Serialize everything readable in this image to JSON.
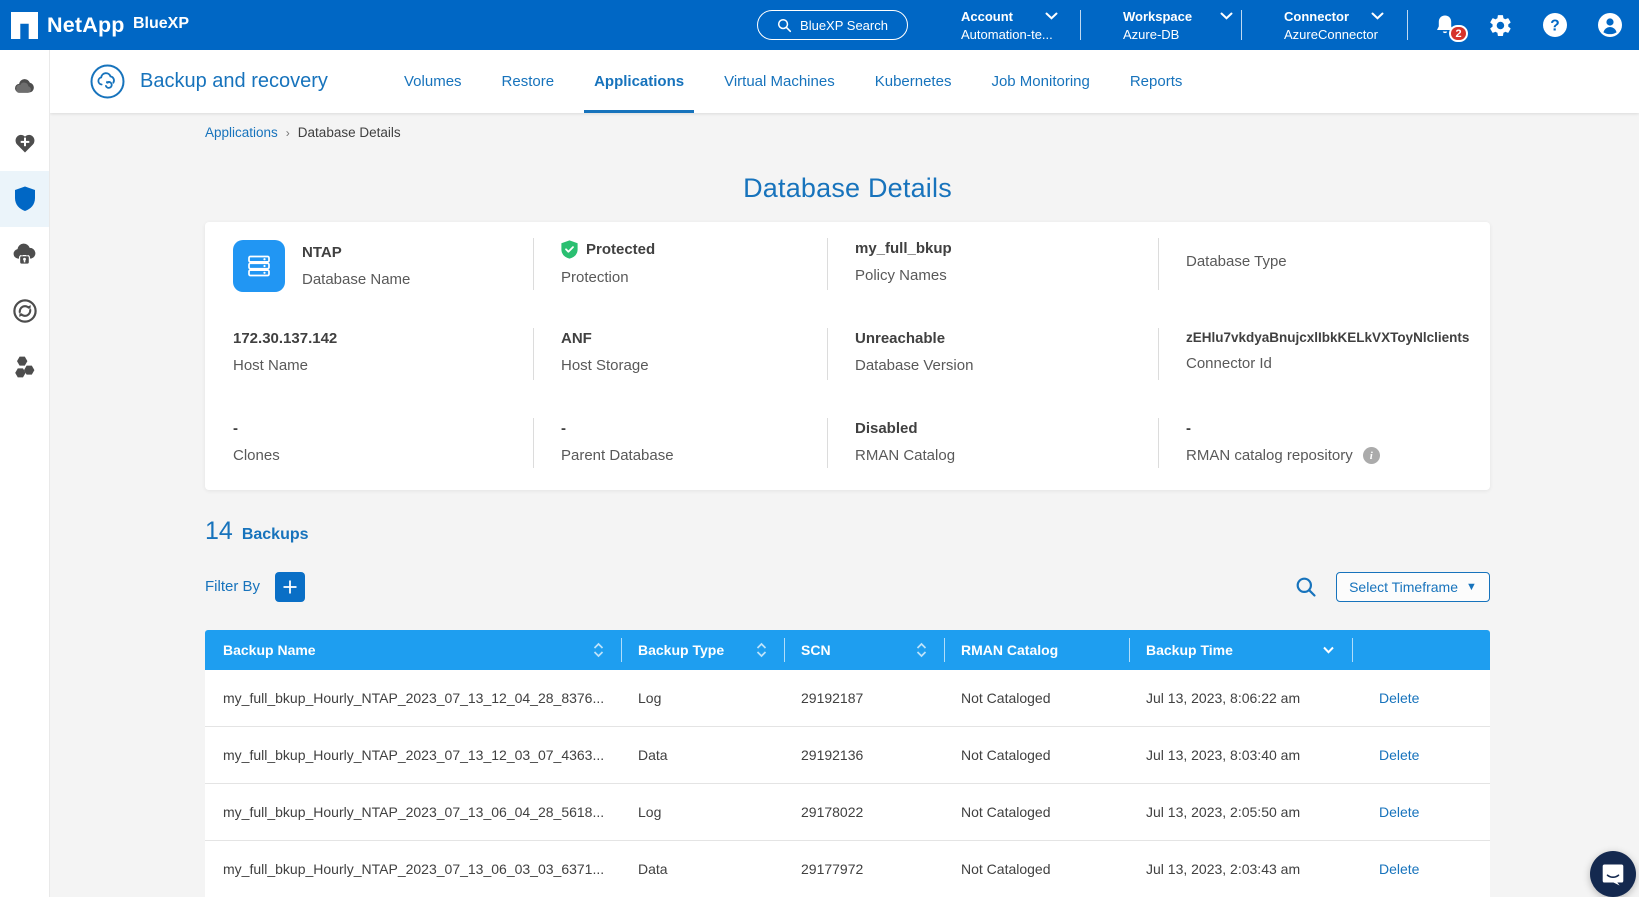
{
  "colors": {
    "brand_blue": "#0067C5",
    "link_blue": "#1773BC",
    "table_header_blue": "#1E9EF0",
    "icon_blue": "#2196F3",
    "protected_green": "#2ABF71",
    "badge_red": "#D6332B",
    "chat_navy": "#14294F"
  },
  "topbar": {
    "brand": "NetApp",
    "product": "BlueXP",
    "search_label": "BlueXP Search",
    "contexts": [
      {
        "label": "Account",
        "value": "Automation-te..."
      },
      {
        "label": "Workspace",
        "value": "Azure-DB"
      },
      {
        "label": "Connector",
        "value": "AzureConnector"
      }
    ],
    "notification_count": "2"
  },
  "service_header": {
    "title": "Backup and recovery",
    "tabs": [
      {
        "label": "Volumes"
      },
      {
        "label": "Restore"
      },
      {
        "label": "Applications"
      },
      {
        "label": "Virtual Machines"
      },
      {
        "label": "Kubernetes"
      },
      {
        "label": "Job Monitoring"
      },
      {
        "label": "Reports"
      }
    ]
  },
  "breadcrumb": {
    "parent": "Applications",
    "current": "Database Details"
  },
  "page": {
    "title": "Database Details"
  },
  "details_card": {
    "cells": [
      {
        "value": "NTAP",
        "label": "Database Name"
      },
      {
        "value": "Protected",
        "label": "Protection"
      },
      {
        "value": "my_full_bkup",
        "label": "Policy Names"
      },
      {
        "value": "",
        "label": "Database Type"
      },
      {
        "value": "172.30.137.142",
        "label": "Host Name"
      },
      {
        "value": "ANF",
        "label": "Host Storage"
      },
      {
        "value": "Unreachable",
        "label": "Database Version"
      },
      {
        "value": "zEHlu7vkdyaBnujcxlIbkKELkVXToyNlclients",
        "label": "Connector Id"
      },
      {
        "value": "-",
        "label": "Clones"
      },
      {
        "value": "-",
        "label": "Parent Database"
      },
      {
        "value": "Disabled",
        "label": "RMAN Catalog"
      },
      {
        "value": "-",
        "label": "RMAN catalog repository"
      }
    ]
  },
  "backups": {
    "count": "14",
    "count_label": "Backups",
    "filter_label": "Filter By",
    "timeframe_label": "Select Timeframe",
    "timeframe_caret": "▼",
    "table": {
      "columns": [
        "Backup Name",
        "Backup Type",
        "SCN",
        "RMAN Catalog",
        "Backup Time"
      ],
      "action_label": "Delete",
      "rows": [
        {
          "name": "my_full_bkup_Hourly_NTAP_2023_07_13_12_04_28_8376...",
          "type": "Log",
          "scn": "29192187",
          "rman": "Not Cataloged",
          "time": "Jul 13, 2023, 8:06:22 am"
        },
        {
          "name": "my_full_bkup_Hourly_NTAP_2023_07_13_12_03_07_4363...",
          "type": "Data",
          "scn": "29192136",
          "rman": "Not Cataloged",
          "time": "Jul 13, 2023, 8:03:40 am"
        },
        {
          "name": "my_full_bkup_Hourly_NTAP_2023_07_13_06_04_28_5618...",
          "type": "Log",
          "scn": "29178022",
          "rman": "Not Cataloged",
          "time": "Jul 13, 2023, 2:05:50 am"
        },
        {
          "name": "my_full_bkup_Hourly_NTAP_2023_07_13_06_03_03_6371...",
          "type": "Data",
          "scn": "29177972",
          "rman": "Not Cataloged",
          "time": "Jul 13, 2023, 2:03:43 am"
        }
      ]
    }
  }
}
